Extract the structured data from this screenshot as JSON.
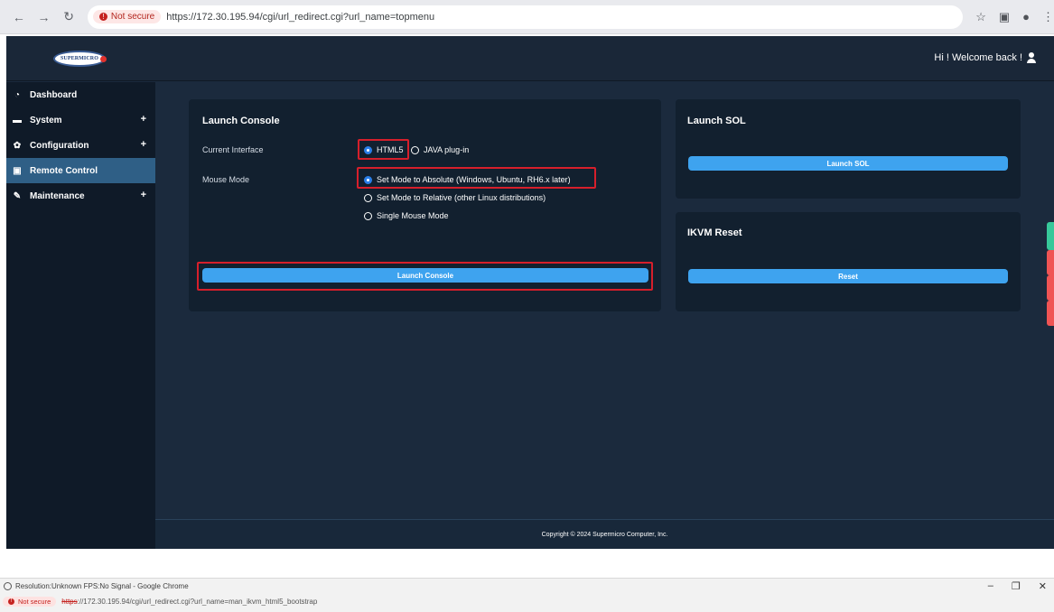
{
  "browser": {
    "not_secure": "Not secure",
    "url": "https://172.30.195.94/cgi/url_redirect.cgi?url_name=topmenu"
  },
  "header": {
    "logo_text": "SUPERMICRO",
    "welcome": "Hi ! Welcome back !"
  },
  "sidebar": {
    "items": [
      {
        "label": "Dashboard",
        "icon": "dashboard-icon",
        "expandable": false
      },
      {
        "label": "System",
        "icon": "monitor-icon",
        "expandable": true
      },
      {
        "label": "Configuration",
        "icon": "gear-icon",
        "expandable": true
      },
      {
        "label": "Remote Control",
        "icon": "terminal-icon",
        "expandable": false,
        "active": true
      },
      {
        "label": "Maintenance",
        "icon": "wrench-icon",
        "expandable": true
      }
    ]
  },
  "launch_console": {
    "title": "Launch Console",
    "current_interface_label": "Current Interface",
    "interface_options": [
      "HTML5",
      "JAVA plug-in"
    ],
    "mouse_mode_label": "Mouse Mode",
    "mouse_options": [
      "Set Mode to Absolute (Windows, Ubuntu, RH6.x later)",
      "Set Mode to Relative (other Linux distributions)",
      "Single Mouse Mode"
    ],
    "button": "Launch Console"
  },
  "launch_sol": {
    "title": "Launch SOL",
    "button": "Launch SOL"
  },
  "ikvm_reset": {
    "title": "IKVM Reset",
    "button": "Reset"
  },
  "footer": {
    "copyright": "Copyright © 2024 Supermicro Computer, Inc."
  },
  "window2": {
    "title": "Resolution:Unknown FPS:No Signal - Google Chrome",
    "not_secure": "Not secure",
    "url_scheme": "https",
    "url_rest": "://172.30.195.94/cgi/url_redirect.cgi?url_name=man_ikvm_html5_bootstrap",
    "minimize": "–",
    "restore": "❐",
    "close": "✕"
  },
  "colors": {
    "accent_blue": "#3ea3ef",
    "highlight_red": "#d61f2b",
    "sidebar_active": "#2f5f86"
  }
}
